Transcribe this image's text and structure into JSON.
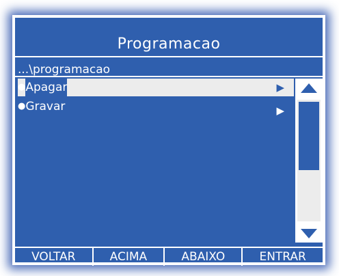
{
  "screen": {
    "title": "Programacao",
    "path": "...\\programacao"
  },
  "menu": {
    "items": [
      {
        "bullet": "●",
        "label": "Apagar",
        "arrow": "▶",
        "selected": true
      },
      {
        "bullet": "●",
        "label": "Gravar",
        "arrow": "▶",
        "selected": false
      }
    ]
  },
  "scrollbar": {
    "up_icon": "triangle-up-icon",
    "down_icon": "triangle-down-icon"
  },
  "softkeys": [
    {
      "label": "VOLTAR"
    },
    {
      "label": "ACIMA"
    },
    {
      "label": "ABAIXO"
    },
    {
      "label": "ENTRAR"
    }
  ],
  "colors": {
    "panel_blue": "#2f5fae",
    "highlight": "#ececec",
    "text": "#ffffff"
  }
}
